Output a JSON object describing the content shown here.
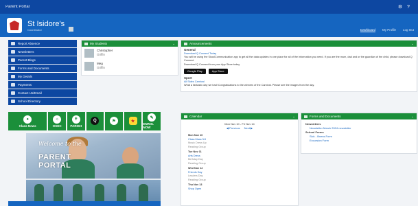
{
  "topbar": {
    "title": "Parent Portal",
    "icons": [
      "settings-icon",
      "help-icon"
    ]
  },
  "header": {
    "school_name": "St Isidore's",
    "school_sub": "Coordinator",
    "links": [
      {
        "label": "Dashboard",
        "active": true
      },
      {
        "label": "My Profile",
        "active": false
      },
      {
        "label": "Log Out",
        "active": false
      }
    ]
  },
  "menu": [
    {
      "label": "Report Absence",
      "icon": "calendar-icon"
    },
    {
      "label": "Newsletters",
      "icon": "newspaper-icon"
    },
    {
      "label": "Parent Blogs",
      "icon": "bell-icon"
    },
    {
      "label": "Forms and Documents",
      "icon": "document-icon"
    },
    {
      "label": "My Details",
      "icon": "user-icon"
    },
    {
      "label": "Payments",
      "icon": "card-icon"
    },
    {
      "label": "Contact Us/Email",
      "icon": "mail-icon"
    },
    {
      "label": "School Directory",
      "icon": "list-icon"
    }
  ],
  "tiles": [
    {
      "label": "Class News",
      "icon": "people-icon"
    },
    {
      "label": "OSHC",
      "icon": "sun-icon"
    },
    {
      "label": "PARISH",
      "icon": "church-icon"
    },
    {
      "label": "",
      "icon": "qkr-icon"
    },
    {
      "label": "",
      "icon": "flag-icon"
    },
    {
      "label": "",
      "icon": "project-icon"
    },
    {
      "label": "ENROL NOW",
      "icon": "enrol-icon"
    }
  ],
  "portal": {
    "welcome": "Welcome to the",
    "title1": "PARENT",
    "title2": "PORTAL"
  },
  "students": {
    "title": "My Students",
    "items": [
      {
        "name": "Christopher",
        "sub": "Griffin"
      },
      {
        "name": "Meg",
        "sub": "Griffin"
      }
    ]
  },
  "announcements": {
    "title": "Announcements",
    "item1_title": "General",
    "item1_link": "Download Q Connect Today",
    "item1_text": "You will be using the SkoolCommunication app to get all the data updates in one place for all of the information you need. If you are the mum, dad and or the guardian of the child, please download Q Connect.",
    "item1_note": "Download Q Connect from your App Store today",
    "stores": [
      "Google Play",
      "App Store"
    ],
    "item2_title": "Sport",
    "item2_link": "All Sides Carnival",
    "item2_text": "What a fantastic day we had! Congratulations to the winners of the Carnival. Please see the images from the day."
  },
  "calendar": {
    "title": "Calendar",
    "range": "Mon Nov 10 - Fri Nov 14",
    "nav_prev": "◀ Previous",
    "nav_next": "Next ▶",
    "days": [
      {
        "day": "Mon Nov 10",
        "events": [
          {
            "e": "Class Mass 3/4",
            "s": "Music Dress Up"
          },
          {
            "e": "",
            "s": "Reading Group"
          }
        ]
      },
      {
        "day": "Tue Nov 11",
        "events": [
          {
            "e": "Arts Dress",
            "s": "Birthday Day"
          },
          {
            "e": "",
            "s": "Reading Group"
          }
        ]
      },
      {
        "day": "Wed Nov 12",
        "events": [
          {
            "e": "Friends Day",
            "s": "Leaders Day"
          },
          {
            "e": "",
            "s": "Reading Group"
          }
        ]
      },
      {
        "day": "Thu Nov 13",
        "events": [
          {
            "e": "Shop Open",
            "s": "Bus Trip"
          }
        ]
      }
    ]
  },
  "forms": {
    "title": "Forms and Documents",
    "groups": [
      {
        "name": "Newsletters",
        "items": [
          "Newsletter March 2024 newsletter"
        ]
      },
      {
        "name": "School Forms",
        "items": [
          "Sick - Illness Form",
          "Excursion Form"
        ]
      }
    ]
  },
  "colors": {
    "primary": "#0d47a1",
    "header": "#1565c0",
    "accent": "#1b8f3a"
  }
}
